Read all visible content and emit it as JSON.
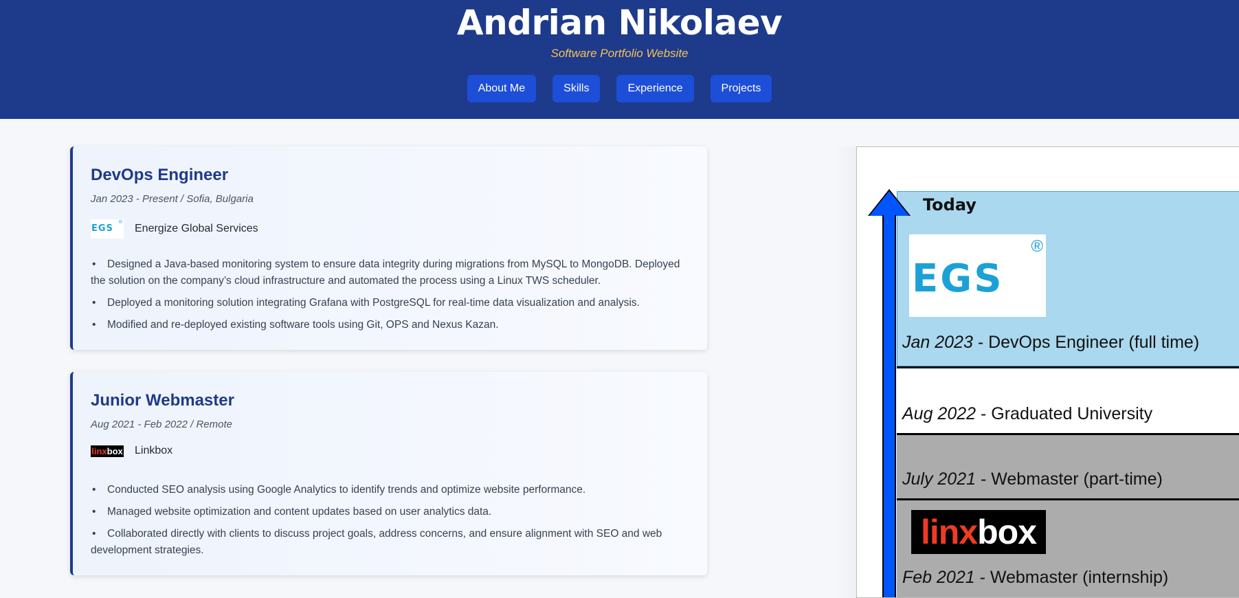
{
  "header": {
    "title": "Andrian Nikolaev",
    "subtitle": "Software Portfolio Website",
    "nav": [
      {
        "label": "About Me"
      },
      {
        "label": "Skills"
      },
      {
        "label": "Experience"
      },
      {
        "label": "Projects"
      }
    ]
  },
  "experience": [
    {
      "title": "DevOps Engineer",
      "meta": "Jan 2023 - Present / Sofia, Bulgaria",
      "company": "Energize Global Services",
      "logo": {
        "text": "EGS",
        "mark": "®"
      },
      "bullets": [
        "Designed a Java-based monitoring system to ensure data integrity during migrations from MySQL to MongoDB. Deployed the solution on the company’s cloud infrastructure and automated the process using a Linux TWS scheduler.",
        "Deployed a monitoring solution integrating Grafana with PostgreSQL for real-time data visualization and analysis.",
        "Modified and re-deployed existing software tools using Git, OPS and Nexus Kazan."
      ]
    },
    {
      "title": "Junior Webmaster",
      "meta": "Aug 2021 - Feb 2022 / Remote",
      "company": "Linkbox",
      "logo": {
        "text_red": "linx",
        "text_white": "box"
      },
      "bullets": [
        "Conducted SEO analysis using Google Analytics to identify trends and optimize website performance.",
        "Managed website optimization and content updates based on user analytics data.",
        "Collaborated directly with clients to discuss project goals, address concerns, and ensure alignment with SEO and web development strategies."
      ]
    }
  ],
  "timeline": {
    "top_label": "Today",
    "entries": [
      {
        "date": "Jan 2023",
        "text": " - DevOps Engineer (full time)"
      },
      {
        "date": "Aug 2022",
        "text": " - Graduated University"
      },
      {
        "date": "July 2021",
        "text": " - Webmaster (part-time)"
      },
      {
        "date": "Feb 2021",
        "text": " - Webmaster (internship)"
      }
    ],
    "egs_logo": {
      "text": "EGS",
      "mark": "®"
    },
    "linkbox_logo": {
      "text_red": "linx",
      "text_white": "box"
    }
  },
  "colors": {
    "header_bg": "#1e3a8a",
    "nav_button": "#1d4ed8",
    "accent_gold": "#f6c15b",
    "timeline_blue": "#aad8ee",
    "timeline_gray": "#acacac",
    "arrow_blue": "#0055ff"
  }
}
